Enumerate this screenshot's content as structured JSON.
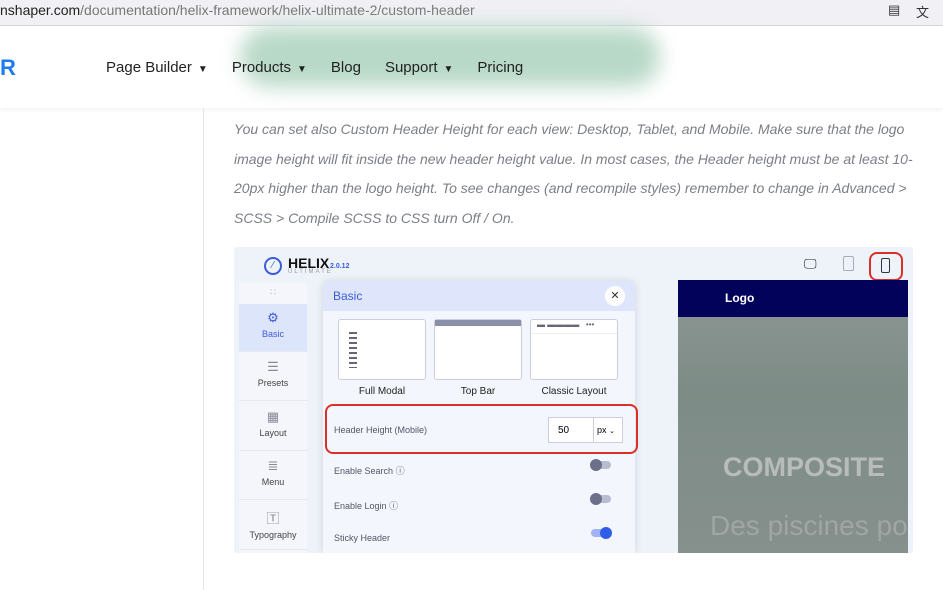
{
  "browser": {
    "url_host": "nshaper.com",
    "url_path": "/documentation/helix-framework/helix-ultimate-2/custom-header"
  },
  "nav": {
    "logo": "R",
    "items": [
      {
        "label": "Page Builder",
        "dropdown": true
      },
      {
        "label": "Products",
        "dropdown": true
      },
      {
        "label": "Blog",
        "dropdown": false
      },
      {
        "label": "Support",
        "dropdown": true
      },
      {
        "label": "Pricing",
        "dropdown": false
      }
    ]
  },
  "content": {
    "paragraph": "You can set also Custom Header Height for each view: Desktop, Tablet, and Mobile. Make sure that the logo image height will fit inside the new header height value. In most cases, the Header height must be at least 10-20px higher than the logo height. To see changes (and recompile styles) remember to change in Advanced > SCSS > Compile SCSS to CSS turn Off / On."
  },
  "screenshot": {
    "brand": "HELIX",
    "brand_sub": "ULTIMATE",
    "version": "2.0.12",
    "sidebar": [
      {
        "label": "Basic",
        "icon": "gear-icon",
        "active": true
      },
      {
        "label": "Presets",
        "icon": "sliders-icon"
      },
      {
        "label": "Layout",
        "icon": "layout-icon"
      },
      {
        "label": "Menu",
        "icon": "menu-icon"
      },
      {
        "label": "Typography",
        "icon": "typography-icon"
      }
    ],
    "panel": {
      "title": "Basic",
      "layouts": [
        "Full Modal",
        "Top Bar",
        "Classic Layout"
      ],
      "header_height_label": "Header Height (Mobile)",
      "header_height_value": "50",
      "unit": "px",
      "toggles": [
        {
          "label": "Enable Search",
          "on": false
        },
        {
          "label": "Enable Login",
          "on": false
        },
        {
          "label": "Sticky Header",
          "on": true
        }
      ]
    },
    "preview": {
      "logo": "Logo",
      "headline": "COMPOSITE",
      "subline": "Des piscines po"
    },
    "accent": "#3b5bdb",
    "highlight": "#d9302a"
  }
}
